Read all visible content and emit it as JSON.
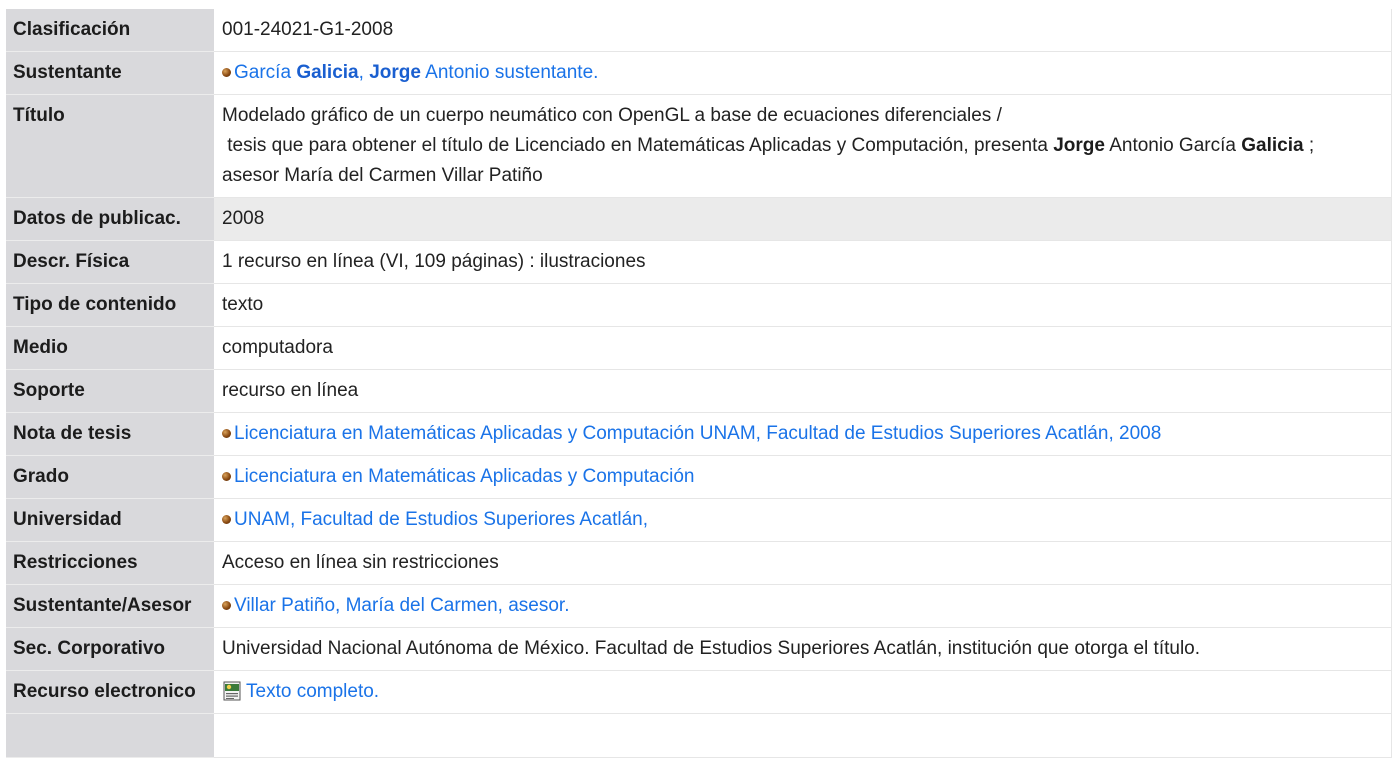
{
  "record": {
    "clasificacion": {
      "label": "Clasificación",
      "value": "001-24021-G1-2008"
    },
    "sustentante": {
      "label": "Sustentante",
      "part1": "García ",
      "part2_bold": "Galicia",
      "part3": ", ",
      "part4_bold": "Jorge",
      "part5": " Antonio sustentante."
    },
    "titulo": {
      "label": "Título",
      "line1": "Modelado gráfico de un cuerpo neumático con OpenGL a base de ecuaciones diferenciales /",
      "line2_a": " tesis que para obtener el título de Licenciado en Matemáticas Aplicadas y Computación, presenta ",
      "line2_b_bold": "Jorge",
      "line2_c": " Antonio García ",
      "line2_d_bold": "Galicia",
      "line2_e": " ;",
      "line3": "asesor María del Carmen Villar Patiño"
    },
    "datos_publicacion": {
      "label": "Datos de publicac.",
      "value": "2008"
    },
    "descr_fisica": {
      "label": "Descr. Física",
      "value": "1 recurso en línea (VI, 109 páginas) : ilustraciones"
    },
    "tipo_contenido": {
      "label": "Tipo de contenido",
      "value": "texto"
    },
    "medio": {
      "label": "Medio",
      "value": "computadora"
    },
    "soporte": {
      "label": "Soporte",
      "value": "recurso en línea"
    },
    "nota_tesis": {
      "label": "Nota de tesis",
      "value": "Licenciatura en Matemáticas Aplicadas y Computación UNAM, Facultad de Estudios Superiores Acatlán, 2008"
    },
    "grado": {
      "label": "Grado",
      "value": "Licenciatura en Matemáticas Aplicadas y Computación"
    },
    "universidad": {
      "label": "Universidad",
      "value": "UNAM, Facultad de Estudios Superiores Acatlán,"
    },
    "restricciones": {
      "label": "Restricciones",
      "value": "Acceso en línea sin restricciones"
    },
    "sustentante_asesor": {
      "label": "Sustentante/Asesor",
      "value": "Villar Patiño, María del Carmen, asesor."
    },
    "sec_corporativo": {
      "label": "Sec. Corporativo",
      "value": "Universidad Nacional Autónoma de México. Facultad de Estudios Superiores Acatlán, institución que otorga el título."
    },
    "recurso_electronico": {
      "label": "Recurso electronico",
      "value": "Texto completo.",
      "icon": "document-icon"
    }
  },
  "colors": {
    "label_bg": "#d9d9dc",
    "link": "#1a73e8",
    "shaded_row": "#ebebeb"
  }
}
